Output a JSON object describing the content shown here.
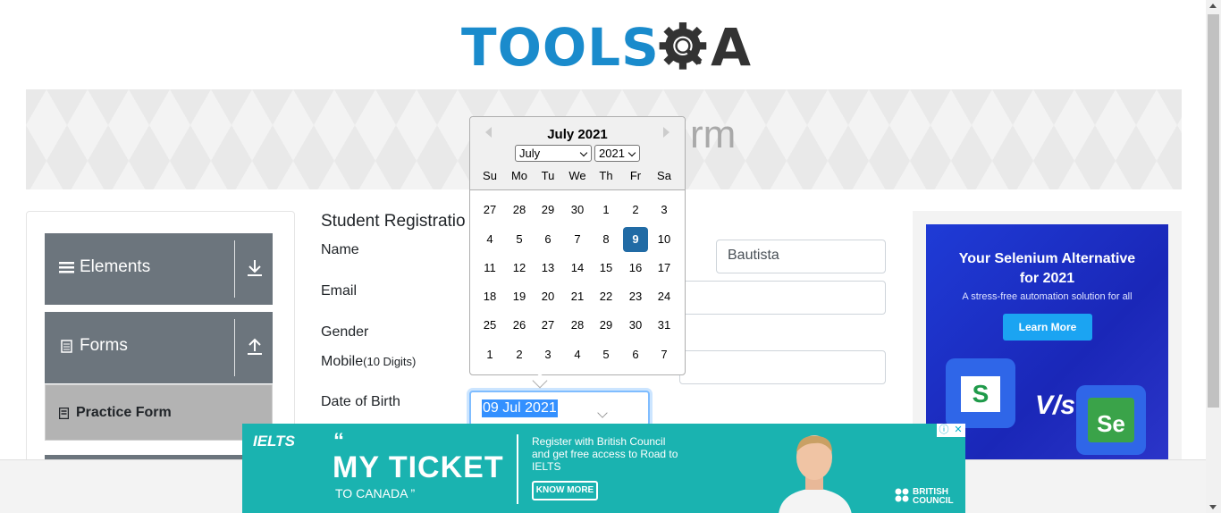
{
  "logo": {
    "text_tools": "TOOLS",
    "text_qa": "QA"
  },
  "banner": {
    "title": "rm"
  },
  "sidebar": {
    "groups": [
      {
        "label": "Elements",
        "icon": "hamburger-icon",
        "arrow": "download-arrow-icon"
      },
      {
        "label": "Forms",
        "icon": "document-icon",
        "arrow": "upload-arrow-icon"
      }
    ],
    "active_item": {
      "label": "Practice Form",
      "icon": "form-icon"
    }
  },
  "form": {
    "heading": "Student Registratio",
    "name_label": "Name",
    "last_name_value": "Bautista",
    "email_label": "Email",
    "gender_label": "Gender",
    "mobile_label": "Mobile",
    "mobile_hint": "(10 Digits)",
    "dob_label": "Date of Birth",
    "dob_value": "09 Jul 2021"
  },
  "datepicker": {
    "title": "July 2021",
    "month_select": "July",
    "year_select": "2021",
    "day_names": [
      "Su",
      "Mo",
      "Tu",
      "We",
      "Th",
      "Fr",
      "Sa"
    ],
    "weeks": [
      [
        "27",
        "28",
        "29",
        "30",
        "1",
        "2",
        "3"
      ],
      [
        "4",
        "5",
        "6",
        "7",
        "8",
        "9",
        "10"
      ],
      [
        "11",
        "12",
        "13",
        "14",
        "15",
        "16",
        "17"
      ],
      [
        "18",
        "19",
        "20",
        "21",
        "22",
        "23",
        "24"
      ],
      [
        "25",
        "26",
        "27",
        "28",
        "29",
        "30",
        "31"
      ],
      [
        "1",
        "2",
        "3",
        "4",
        "5",
        "6",
        "7"
      ]
    ],
    "selected_day": "9"
  },
  "ad_right": {
    "headline_1": "Your Selenium Alternative",
    "headline_2": "for 2021",
    "sub": "A stress-free automation solution for all",
    "button": "Learn More",
    "logo_s": "S",
    "vs": "V/s",
    "logo_se": "Se"
  },
  "ad_bottom": {
    "brand": "IELTS",
    "quote_open": "“",
    "headline": "MY TICKET",
    "sub": "TO CANADA ”",
    "message": "Register with British Council and get free access to Road to IELTS",
    "button": "KNOW MORE",
    "sponsor_1": "BRITISH",
    "sponsor_2": "COUNCIL",
    "info_icon": "ⓘ",
    "close_icon": "✕"
  },
  "colors": {
    "accent": "#1a8bcc",
    "selected": "#216ba5",
    "sidebar_group": "#6c757d"
  }
}
